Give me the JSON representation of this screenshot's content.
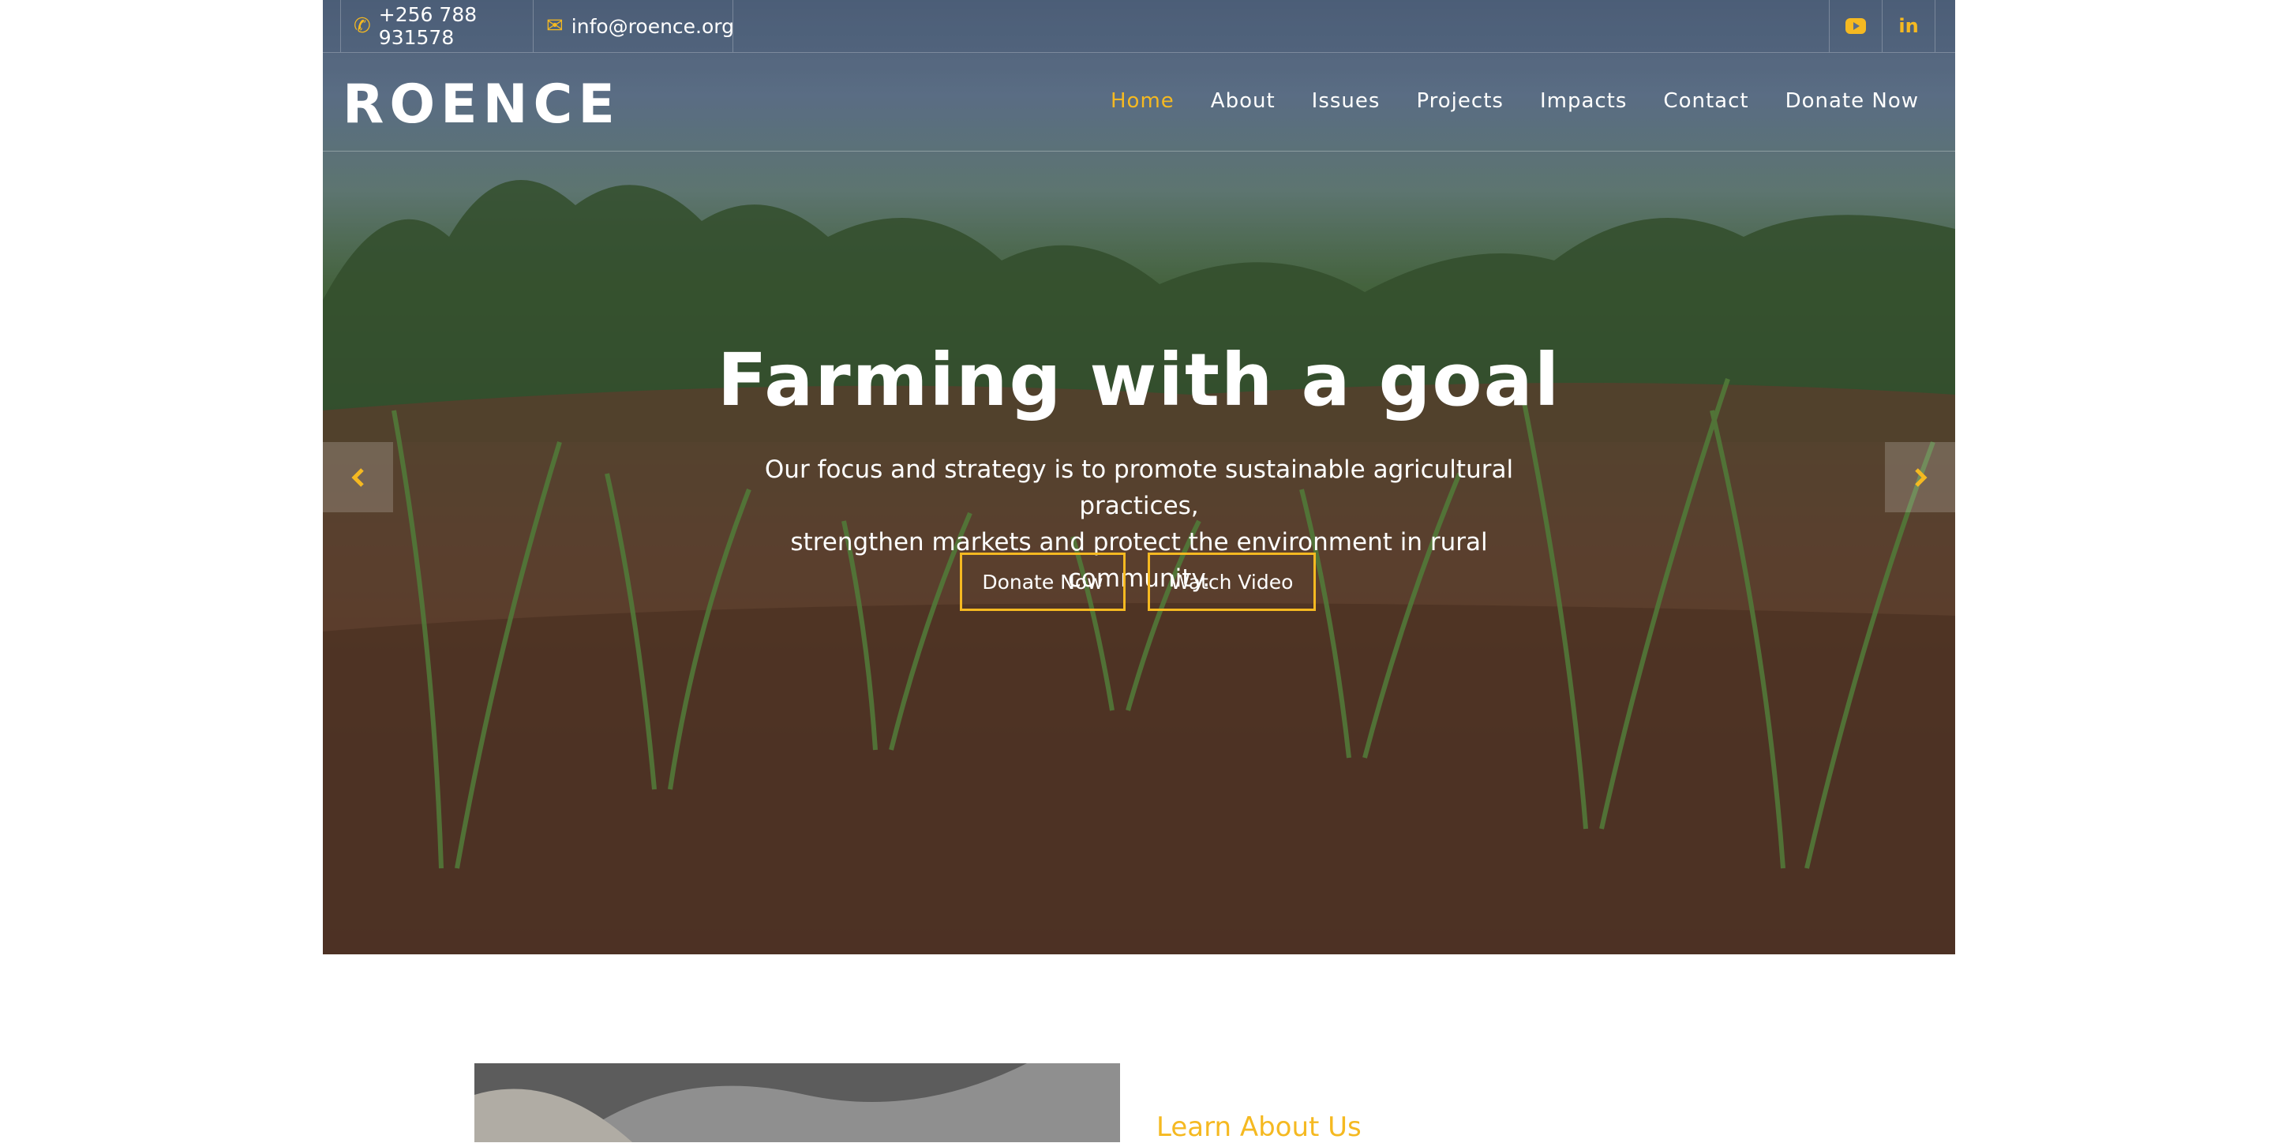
{
  "colors": {
    "accent": "#f5b921",
    "text_light": "#ffffff"
  },
  "topbar": {
    "phone": {
      "icon": "phone-icon",
      "text": "+256 788 931578"
    },
    "email": {
      "icon": "envelope-icon",
      "text": "info@roence.org"
    },
    "social": [
      {
        "icon": "youtube-icon"
      },
      {
        "icon": "linkedin-icon"
      }
    ]
  },
  "navbar": {
    "logo": "ROENCE",
    "items": [
      {
        "label": "Home",
        "active": true
      },
      {
        "label": "About"
      },
      {
        "label": "Issues"
      },
      {
        "label": "Projects"
      },
      {
        "label": "Impacts"
      },
      {
        "label": "Contact"
      },
      {
        "label": "Donate Now"
      }
    ]
  },
  "hero": {
    "title": "Farming with a goal",
    "subtitle_line1": "Our focus and strategy is to promote sustainable agricultural practices,",
    "subtitle_line2": "strengthen markets and protect the environment in rural community.",
    "primary_button": "Donate Now",
    "secondary_button": "Watch Video",
    "prev_icon": "chevron-left-icon",
    "next_icon": "chevron-right-icon"
  },
  "about": {
    "heading": "Learn About Us"
  }
}
